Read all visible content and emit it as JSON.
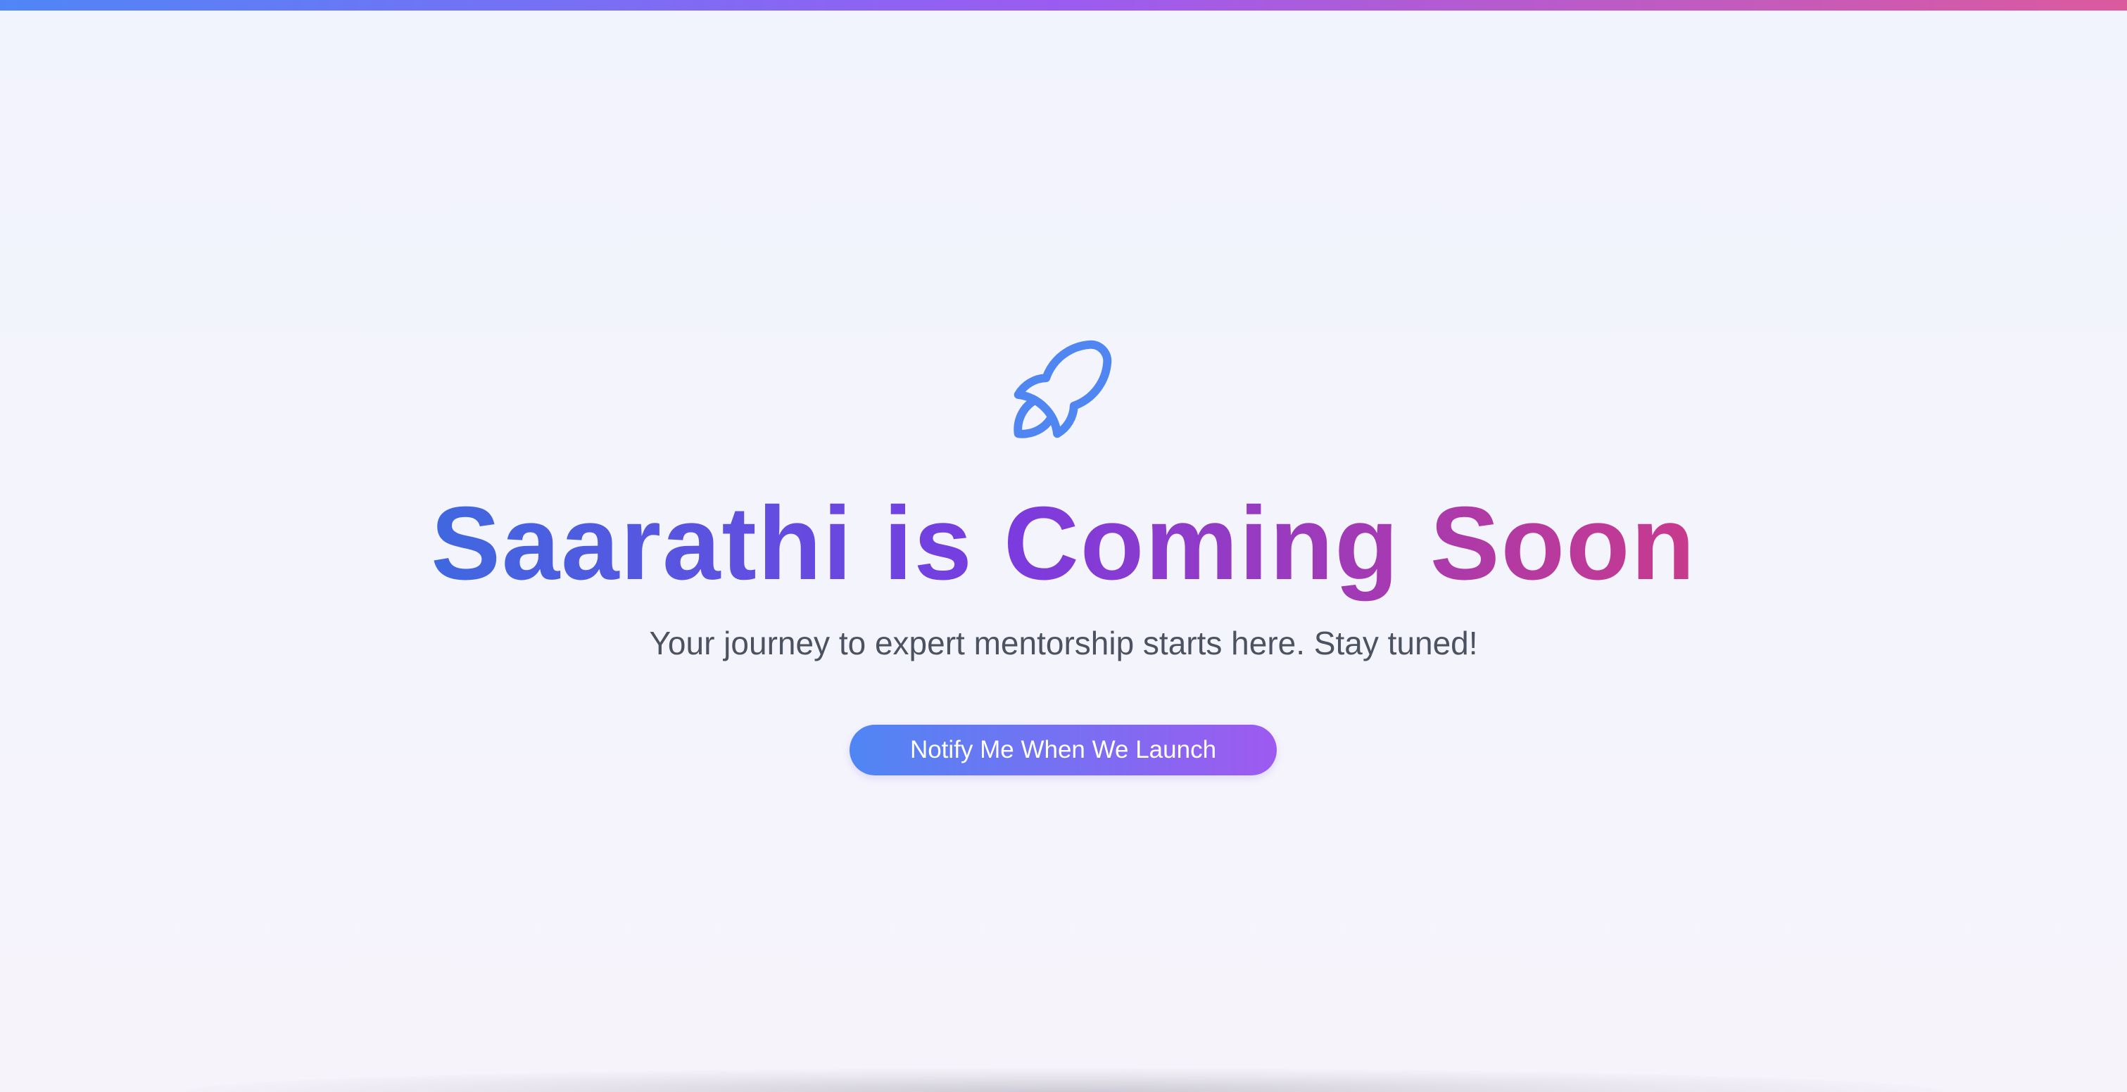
{
  "page": {
    "accent_gradient": [
      "#4f86f7",
      "#9b5cf0",
      "#db5a9e"
    ],
    "background": "#f2f3fc"
  },
  "hero": {
    "icon": "rocket-icon",
    "icon_color": "#4f86f1",
    "title": "Saarathi is Coming Soon",
    "title_gradient": [
      "#3f68e0",
      "#7a3be0",
      "#c83a8c"
    ],
    "subtitle": "Your journey to expert mentorship starts here. Stay tuned!",
    "subtitle_color": "#4b5260",
    "cta": {
      "label": "Notify Me When We Launch",
      "gradient": [
        "#4f86f4",
        "#9e5af0"
      ],
      "text_color": "#ffffff"
    }
  }
}
